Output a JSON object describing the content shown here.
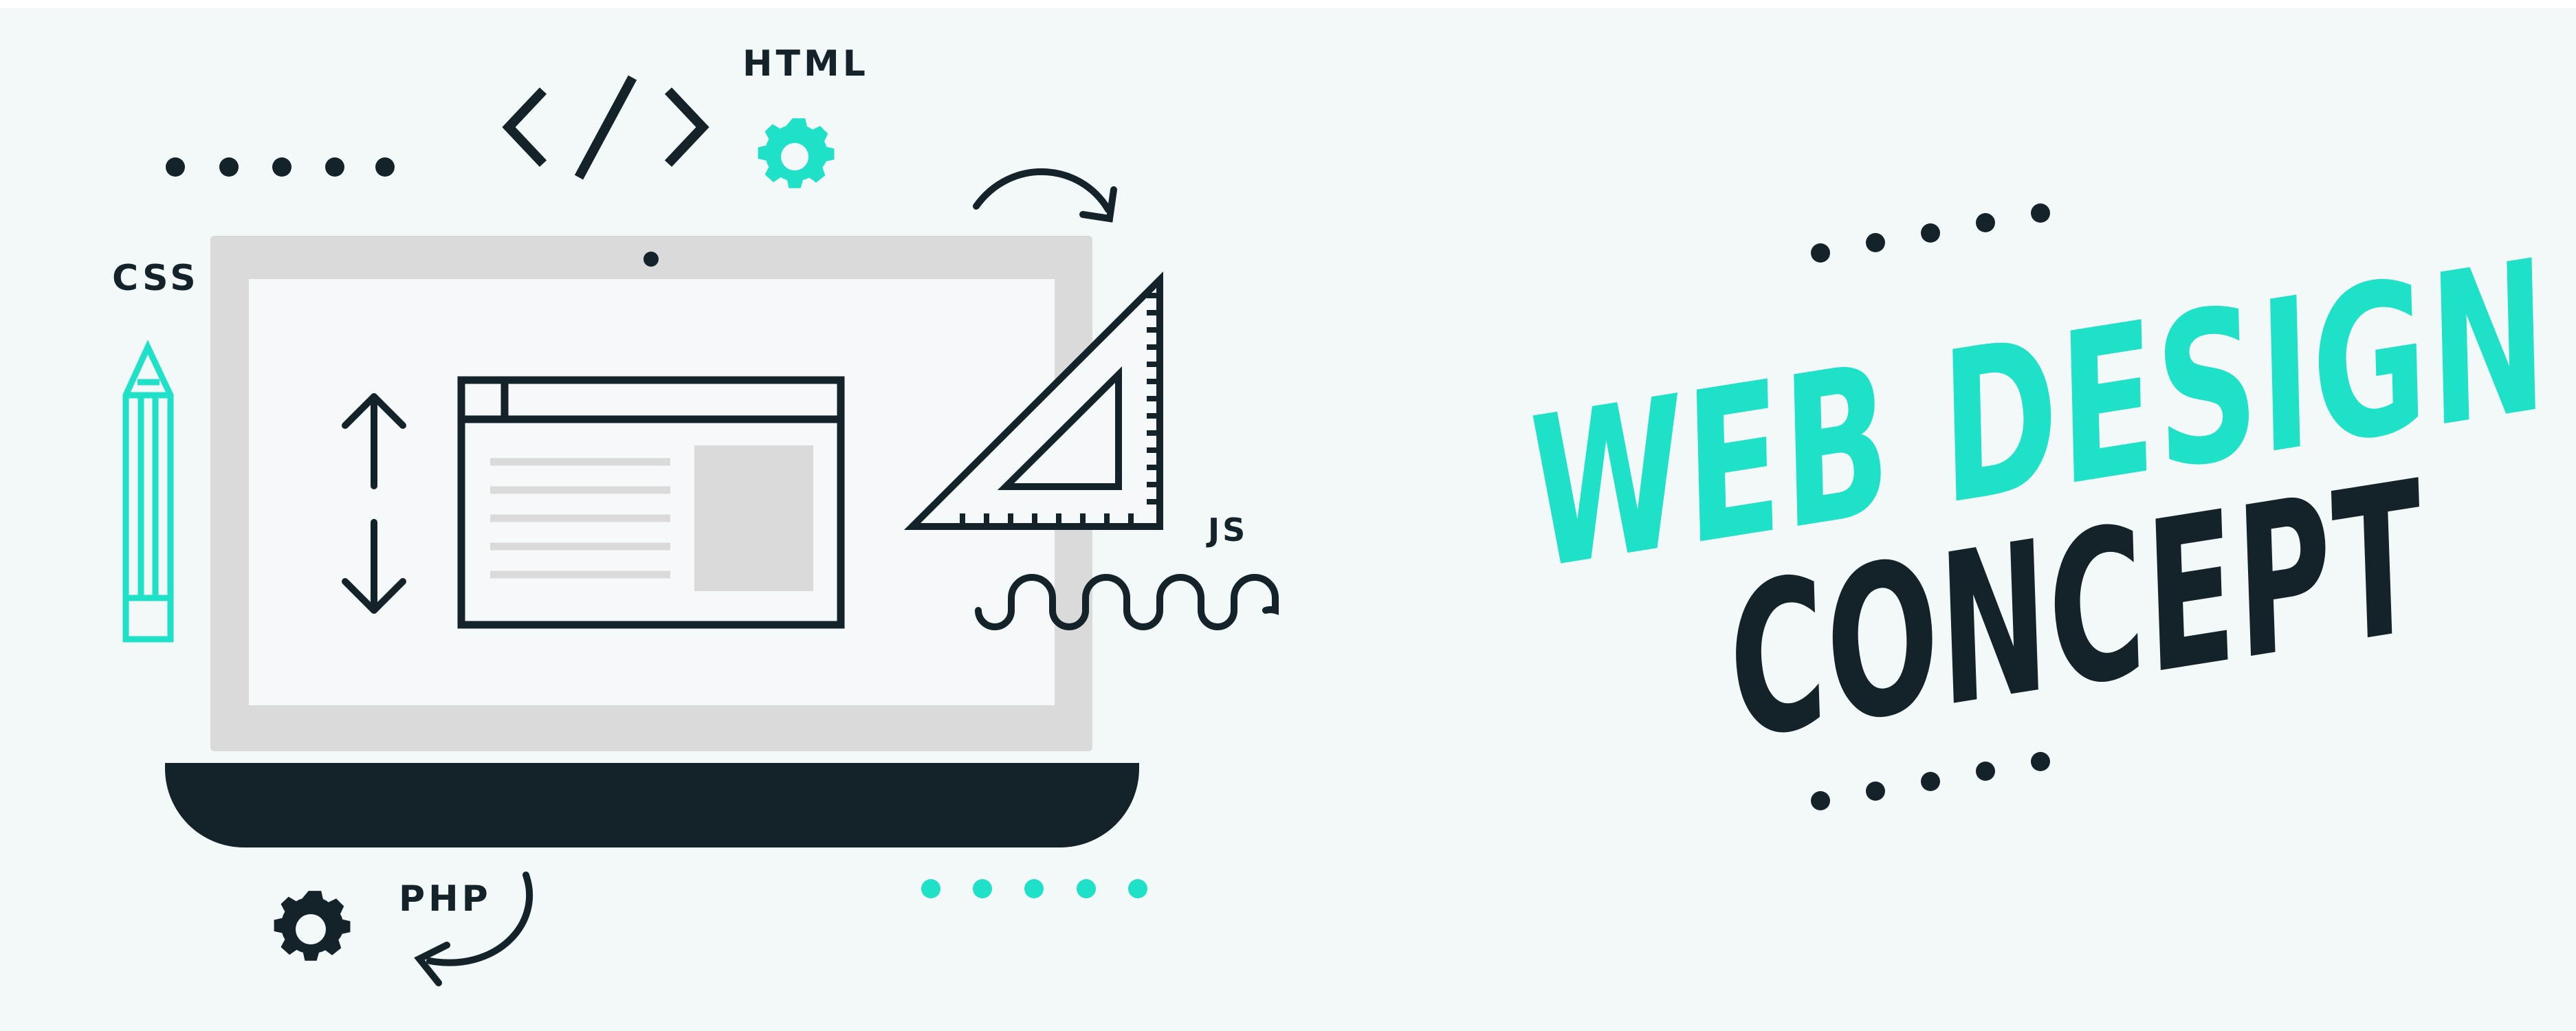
{
  "labels": {
    "html": "HTML",
    "css": "CSS",
    "js": "JS",
    "php": "PHP"
  },
  "headline": {
    "line1": "WEB DESIGN",
    "line2": "CONCEPT"
  },
  "colors": {
    "background": "#F3F8F8",
    "dark": "#14232A",
    "accent": "#1FE1C7",
    "light_gray": "#DADADA",
    "white": "#F5F9F9"
  },
  "icons": [
    "code-brackets-icon",
    "gear-icon",
    "pencil-icon",
    "ruler-triangle-icon",
    "up-down-arrows-icon",
    "curved-arrow-icon",
    "wave-icon",
    "dots-decoration"
  ]
}
